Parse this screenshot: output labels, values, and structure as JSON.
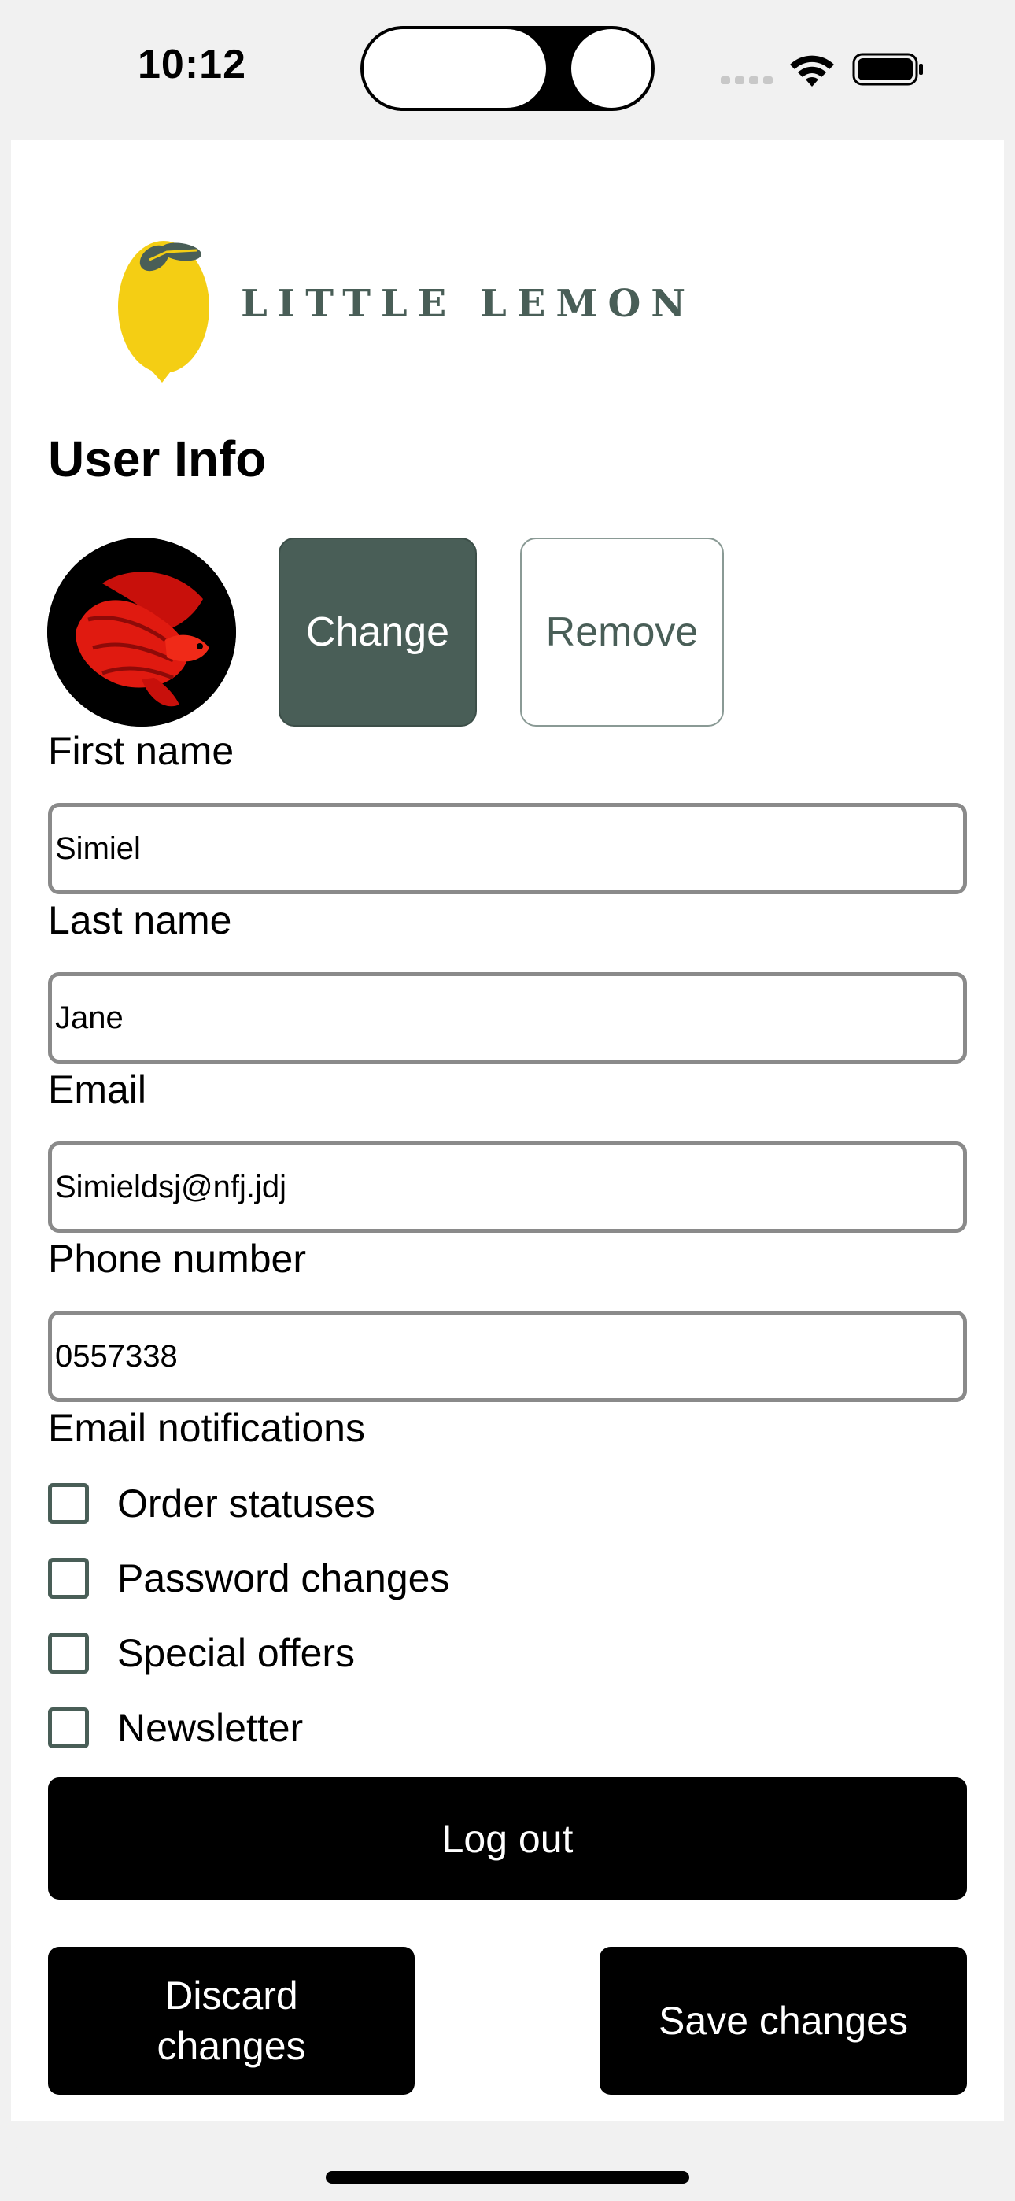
{
  "status_bar": {
    "time": "10:12"
  },
  "brand": {
    "name": "LITTLE LEMON"
  },
  "page": {
    "title": "User Info"
  },
  "avatar": {
    "buttons": {
      "change": "Change",
      "remove": "Remove"
    }
  },
  "form": {
    "first_name": {
      "label": "First name",
      "value": "Simiel"
    },
    "last_name": {
      "label": "Last name",
      "value": "Jane"
    },
    "email": {
      "label": "Email",
      "value": "Simieldsj@nfj.jdj"
    },
    "phone": {
      "label": "Phone number",
      "value": "0557338"
    }
  },
  "notifications": {
    "label": "Email notifications",
    "options": [
      {
        "label": "Order statuses",
        "checked": false
      },
      {
        "label": "Password changes",
        "checked": false
      },
      {
        "label": "Special offers",
        "checked": false
      },
      {
        "label": "Newsletter",
        "checked": false
      }
    ]
  },
  "actions": {
    "logout": "Log out",
    "discard_line1": "Discard",
    "discard_line2": "changes",
    "save": "Save changes"
  },
  "colors": {
    "brand_green": "#495e57",
    "brand_yellow": "#f4ce14",
    "button_dark": "#000000"
  }
}
